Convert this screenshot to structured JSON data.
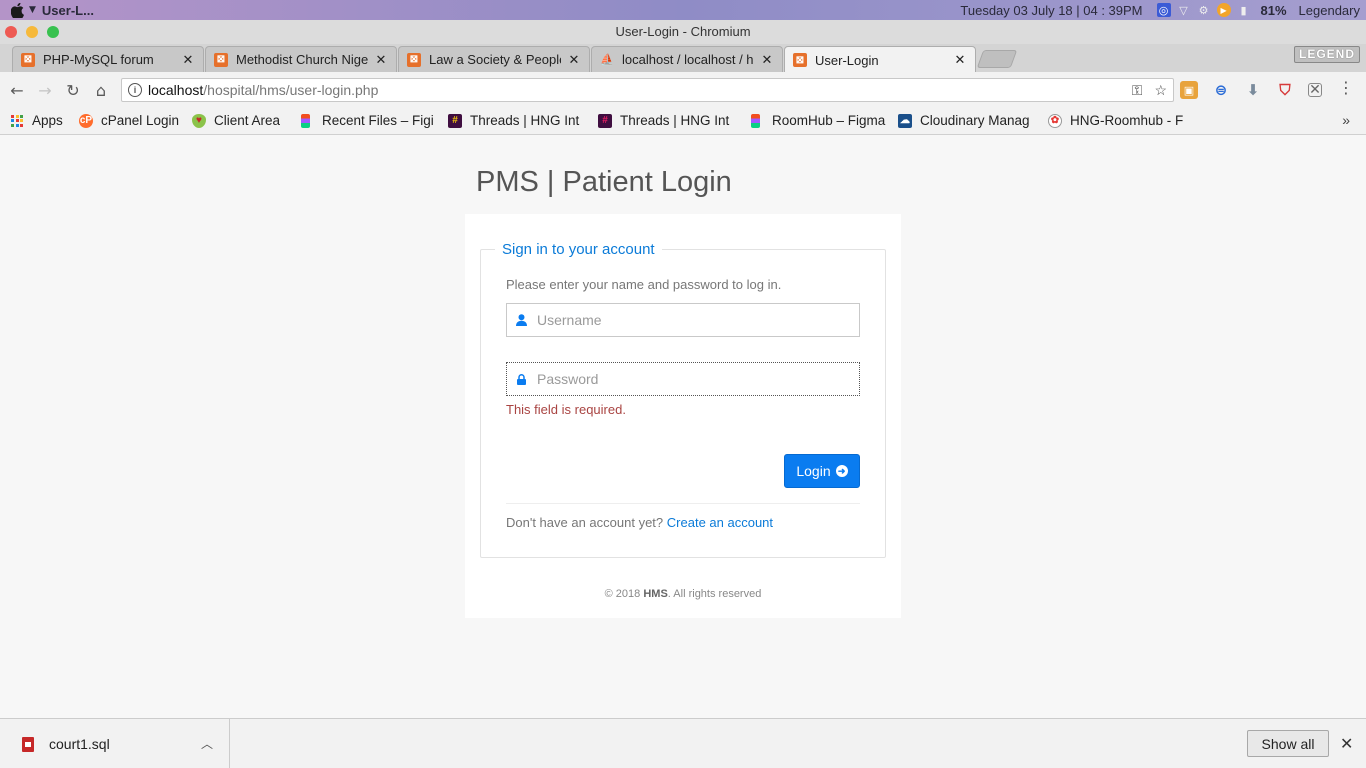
{
  "os_bar": {
    "app_title": "User-L...",
    "datetime": "Tuesday 03 July 18 | 04 : 39PM",
    "battery": "81%",
    "user": "Legendary"
  },
  "window": {
    "title": "User-Login - Chromium"
  },
  "tabs": [
    {
      "label": "PHP-MySQL forum",
      "icon": "xampp-icon",
      "active": false
    },
    {
      "label": "Methodist Church Nige",
      "icon": "xampp-icon",
      "active": false
    },
    {
      "label": "Law a Society & People",
      "icon": "xampp-icon",
      "active": false
    },
    {
      "label": "localhost / localhost / h",
      "icon": "phpmyadmin-icon",
      "active": false
    },
    {
      "label": "User-Login",
      "icon": "xampp-icon",
      "active": true
    }
  ],
  "profile_label": "LEGEND",
  "address_bar": {
    "host": "localhost",
    "path": "/hospital/hms/user-login.php"
  },
  "bookmarks": [
    {
      "label": "Apps",
      "icon": "apps-grid-icon"
    },
    {
      "label": "cPanel Login",
      "icon": "cpanel-icon"
    },
    {
      "label": "Client Area",
      "icon": "shield-icon"
    },
    {
      "label": "Recent Files – Figi",
      "icon": "figma-icon"
    },
    {
      "label": "Threads | HNG Int",
      "icon": "hash-icon"
    },
    {
      "label": "Threads | HNG Int",
      "icon": "hash-icon"
    },
    {
      "label": "RoomHub – Figma",
      "icon": "figma-icon"
    },
    {
      "label": "Cloudinary Manag",
      "icon": "cloudinary-icon"
    },
    {
      "label": "HNG-Roomhub - F",
      "icon": "roomhub-icon"
    }
  ],
  "page": {
    "title": "PMS | Patient Login",
    "form": {
      "legend": "Sign in to your account",
      "hint": "Please enter your name and password to log in.",
      "username_placeholder": "Username",
      "password_placeholder": "Password",
      "error": "This field is required.",
      "login_label": "Login",
      "signup_prompt": "Don't have an account yet?",
      "signup_link": "Create an account"
    },
    "footer": {
      "prefix": "© 2018",
      "brand": "HMS",
      "suffix": ". All rights reserved"
    }
  },
  "downloads": {
    "file_name": "court1.sql",
    "show_all_label": "Show all"
  },
  "colors": {
    "accent": "#0a7cf0",
    "link": "#0b7bd8",
    "error": "#a94442",
    "xampp_orange": "#e6702b"
  }
}
